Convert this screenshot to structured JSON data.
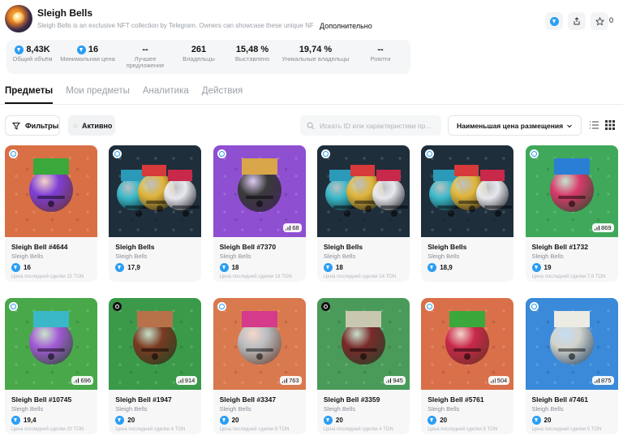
{
  "header": {
    "title": "Sleigh Bells",
    "description": "Sleigh Bells is an exclusive NFT collection by Telegram. Owners can showcase these unique NFTs in the",
    "more_label": "Дополнительно",
    "favorites_count": "0"
  },
  "stats": [
    {
      "value": "8,43K",
      "label": "Общий объём",
      "ton": true
    },
    {
      "value": "16",
      "label": "Минимальная цена",
      "ton": true
    },
    {
      "value": "--",
      "label": "Лучшее предложение",
      "ton": false
    },
    {
      "value": "261",
      "label": "Владельцы",
      "ton": false
    },
    {
      "value": "15,48 %",
      "label": "Выставлено",
      "ton": false
    },
    {
      "value": "19,74 %",
      "label": "Уникальные владельцы",
      "ton": false
    },
    {
      "value": "--",
      "label": "Роялти",
      "ton": false
    }
  ],
  "tabs": [
    "Предметы",
    "Мои предметы",
    "Аналитика",
    "Действия"
  ],
  "active_tab": 0,
  "filters_label": "Фильтры",
  "active_label": "Активно",
  "search_placeholder": "Искать ID или характеристики пр...",
  "sort_label": "Наименьшая цена размещения",
  "items": [
    {
      "name": "Sleigh Bell #4644",
      "collection": "Sleigh Bells",
      "price": "16",
      "last_sale": "Цена последней сделки 15 TON",
      "rank": "",
      "bg": "#d96f45",
      "bell": "#7f3fd6",
      "bow": "#3aa83a",
      "badge": "blue",
      "trio": false
    },
    {
      "name": "Sleigh Bells",
      "collection": "Sleigh Bells",
      "price": "17,9",
      "last_sale": "",
      "rank": "",
      "bg": "#1f2e3b",
      "bell": "#e0b43a",
      "bow": "#d63a3a",
      "badge": "blue",
      "trio": true
    },
    {
      "name": "Sleigh Bell #7370",
      "collection": "Sleigh Bells",
      "price": "18",
      "last_sale": "Цена последней сделки 18 TON",
      "rank": "68",
      "bg": "#8e4fd1",
      "bell": "#3a3a3a",
      "bow": "#d9a64a",
      "badge": "blue",
      "trio": false
    },
    {
      "name": "Sleigh Bells",
      "collection": "Sleigh Bells",
      "price": "18",
      "last_sale": "Цена последней сделки 14 TON",
      "rank": "",
      "bg": "#1f2e3b",
      "bell": "#e0b43a",
      "bow": "#d63a3a",
      "badge": "blue",
      "trio": true
    },
    {
      "name": "Sleigh Bells",
      "collection": "Sleigh Bells",
      "price": "18,9",
      "last_sale": "",
      "rank": "",
      "bg": "#1f2e3b",
      "bell": "#e0b43a",
      "bow": "#d63a3a",
      "badge": "blue",
      "trio": true
    },
    {
      "name": "Sleigh Bell #1732",
      "collection": "Sleigh Bells",
      "price": "19",
      "last_sale": "Цена последней сделки 7,6 TON",
      "rank": "869",
      "bg": "#3fa85a",
      "bell": "#d93a6a",
      "bow": "#2a7fd4",
      "badge": "blue",
      "trio": false
    },
    {
      "name": "Sleigh Bell #10745",
      "collection": "Sleigh Bells",
      "price": "19,4",
      "last_sale": "Цена последней сделки 20 TON",
      "rank": "696",
      "bg": "#49a84a",
      "bell": "#a35ad6",
      "bow": "#3ab8c8",
      "badge": "blue",
      "trio": false
    },
    {
      "name": "Sleigh Bell #1947",
      "collection": "Sleigh Bells",
      "price": "20",
      "last_sale": "Цена последней сделки 4 TON",
      "rank": "914",
      "bg": "#3a9a4a",
      "bell": "#7a3a22",
      "bow": "#b8724a",
      "badge": "dark",
      "trio": false
    },
    {
      "name": "Sleigh Bell #3347",
      "collection": "Sleigh Bells",
      "price": "20",
      "last_sale": "Цена последней сделки 8 TON",
      "rank": "763",
      "bg": "#d9794e",
      "bell": "#b9bcc0",
      "bow": "#d63a8a",
      "badge": "blue",
      "trio": false
    },
    {
      "name": "Sleigh Bell #3359",
      "collection": "Sleigh Bells",
      "price": "20",
      "last_sale": "Цена последней сделки 4 TON",
      "rank": "945",
      "bg": "#4a9a5a",
      "bell": "#7a2a2a",
      "bow": "#c8c8b0",
      "badge": "dark",
      "trio": false
    },
    {
      "name": "Sleigh Bell #5761",
      "collection": "Sleigh Bells",
      "price": "20",
      "last_sale": "Цена последней сделки 8 TON",
      "rank": "504",
      "bg": "#d9704a",
      "bell": "#c8284a",
      "bow": "#3aa83a",
      "badge": "blue",
      "trio": false
    },
    {
      "name": "Sleigh Bell #7461",
      "collection": "Sleigh Bells",
      "price": "20",
      "last_sale": "Цена последней сделки 5 TON",
      "rank": "875",
      "bg": "#3a8ad9",
      "bell": "#d4d4cc",
      "bow": "#ecece4",
      "badge": "blue",
      "trio": false
    }
  ]
}
